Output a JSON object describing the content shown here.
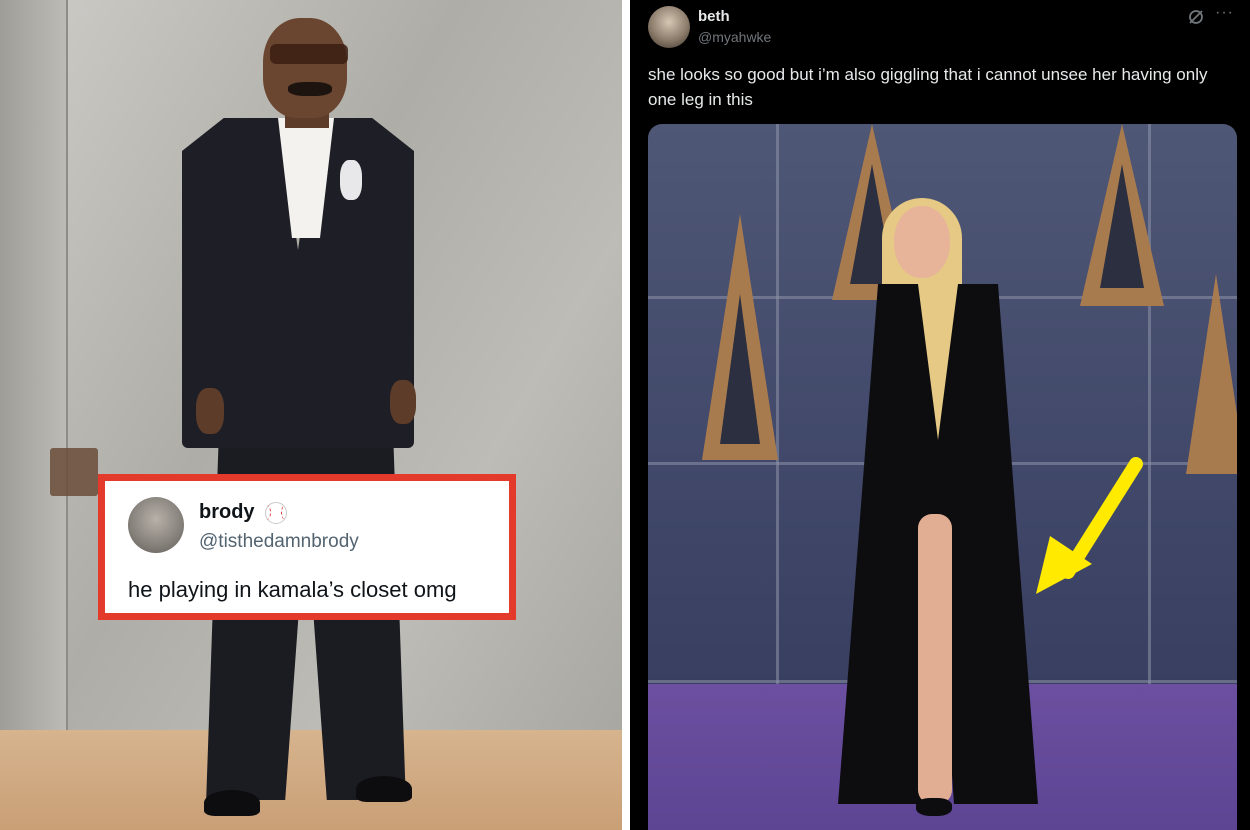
{
  "left_tweet": {
    "name": "brody",
    "name_icon": "baseball-icon",
    "handle": "@tisthedamnbrody",
    "text": "he playing in kamala’s closet omg",
    "border_color": "#e43a2b"
  },
  "right_post": {
    "name": "beth",
    "handle": "@myahwke",
    "text": "she looks so good but i’m also giggling that i cannot unsee her having only one leg in this",
    "more_label": "···",
    "annotation_arrow_color": "#ffea00"
  }
}
